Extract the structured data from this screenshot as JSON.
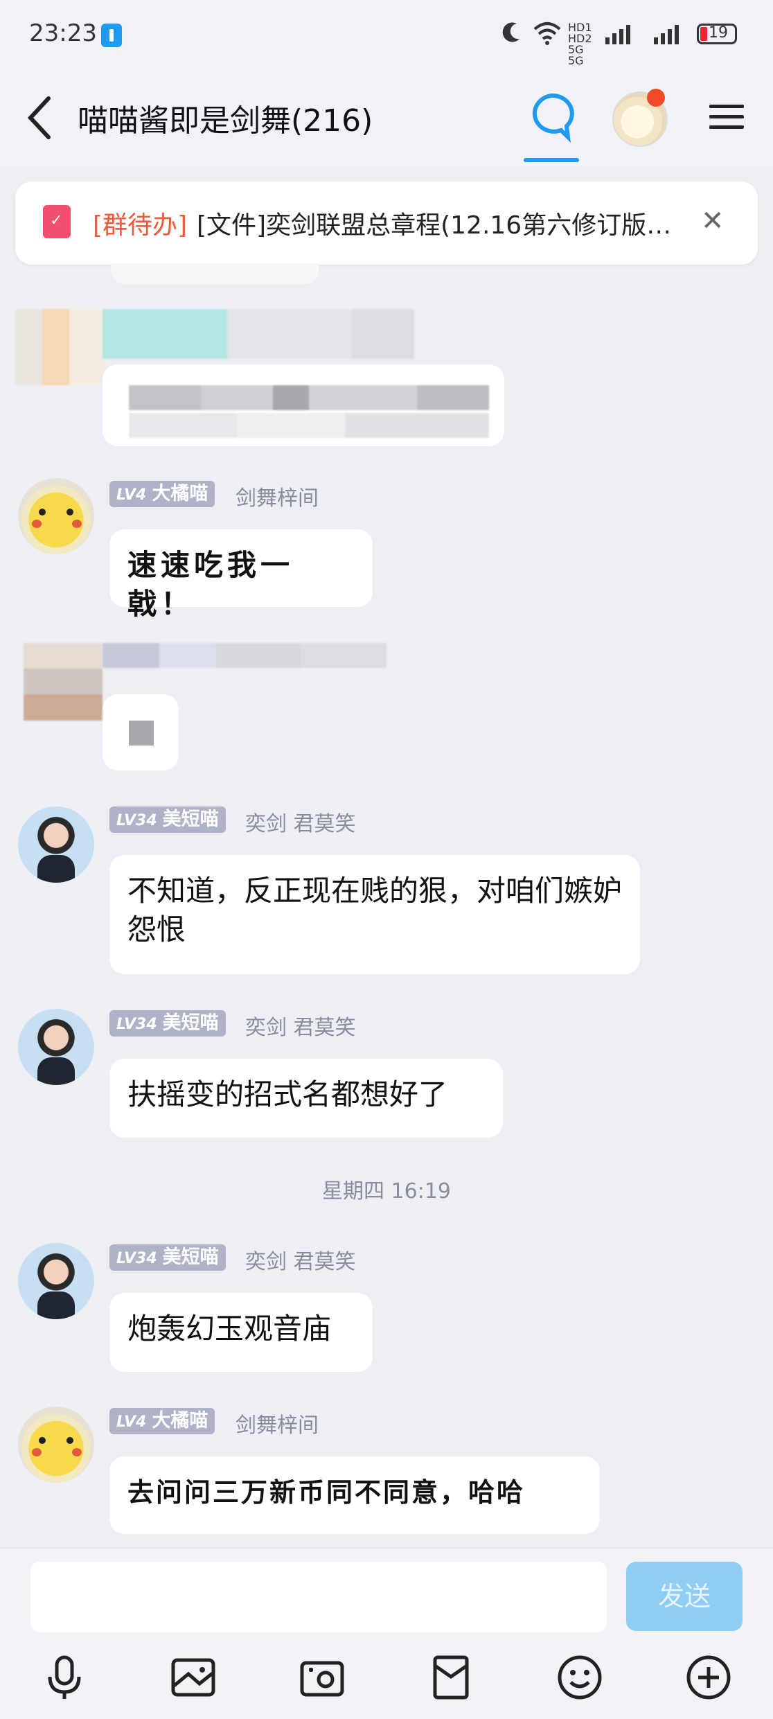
{
  "status_bar": {
    "time": "23:23",
    "network_labels": "HD1 HD2  5G  5G",
    "battery": "19"
  },
  "header": {
    "title": "喵喵酱即是剑舞(216)"
  },
  "todo_banner": {
    "tag": "[群待办]",
    "text": "[文件]奕剑联盟总章程(12.16第六修订版…"
  },
  "messages": [
    {
      "level": "LV4",
      "group_rank": "大橘喵",
      "sender": "剑舞梓间",
      "text": "速速吃我一戟！"
    },
    {
      "level": "LV34",
      "group_rank": "美短喵",
      "sender": "奕剑 君莫笑",
      "text": "不知道，反正现在贱的狠，对咱们嫉妒怨恨"
    },
    {
      "level": "LV34",
      "group_rank": "美短喵",
      "sender": "奕剑 君莫笑",
      "text": "扶摇变的招式名都想好了"
    },
    {
      "level": "LV34",
      "group_rank": "美短喵",
      "sender": "奕剑 君莫笑",
      "text": "炮轰幻玉观音庙"
    },
    {
      "level": "LV4",
      "group_rank": "大橘喵",
      "sender": "剑舞梓间",
      "text": "去问问三万新币同不同意，哈哈"
    }
  ],
  "timestamp": "星期四 16:19",
  "composer": {
    "input_value": "",
    "send_label": "发送"
  },
  "toolbar_icons": [
    "microphone-icon",
    "image-icon",
    "camera-icon",
    "red-packet-icon",
    "emoji-icon",
    "plus-icon"
  ],
  "colors": {
    "accent": "#1e9bf0",
    "todo_tag": "#f05a3a",
    "notif_dot": "#f04a2a",
    "send_disabled": "#8fcdf5"
  }
}
